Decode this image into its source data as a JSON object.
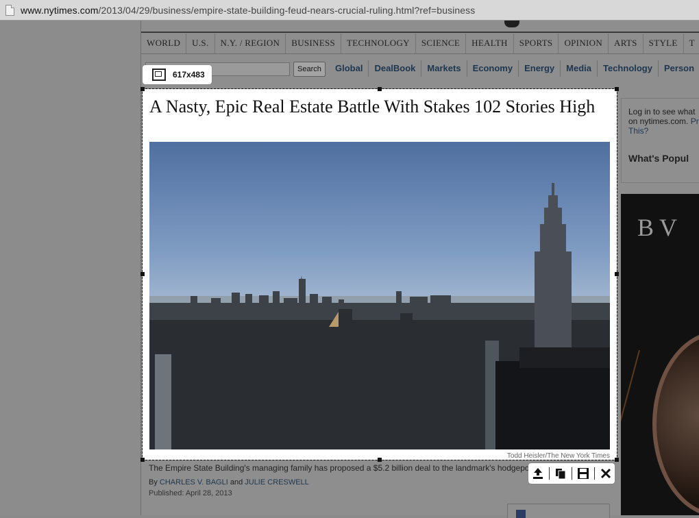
{
  "browser": {
    "url_host": "www.nytimes.com",
    "url_path": "/2013/04/29/business/empire-state-building-feud-nears-crucial-ruling.html?ref=business"
  },
  "nav": {
    "items": [
      "WORLD",
      "U.S.",
      "N.Y. / REGION",
      "BUSINESS",
      "TECHNOLOGY",
      "SCIENCE",
      "HEALTH",
      "SPORTS",
      "OPINION",
      "ARTS",
      "STYLE",
      "T"
    ]
  },
  "subnav": {
    "search_label": "Search",
    "sections": [
      "Global",
      "DealBook",
      "Markets",
      "Economy",
      "Energy",
      "Media",
      "Technology",
      "Person"
    ]
  },
  "article": {
    "headline": "A Nasty, Epic Real Estate Battle With Stakes 102 Stories High",
    "photo_credit": "Todd Heisler/The New York Times",
    "caption": "The Empire State Building's managing family has proposed a $5.2 billion deal to the landmark's hodgepo",
    "byline_prefix": "By",
    "author1": "CHARLES V. BAGLI",
    "byline_and": "and",
    "author2": "JULIE CRESWELL",
    "published": "Published: April 28, 2013"
  },
  "sidebar": {
    "login_text_line1": "Log in to see what",
    "login_text_line2": "on nytimes.com.",
    "login_link": "Pr",
    "login_text_line3": "This?",
    "popular_title": "What's Popul"
  },
  "ad": {
    "brand": "BV"
  },
  "capture": {
    "size_label": "617x483"
  },
  "colors": {
    "accent_link": "#1d3650",
    "overlay": "#8a8a8a"
  }
}
